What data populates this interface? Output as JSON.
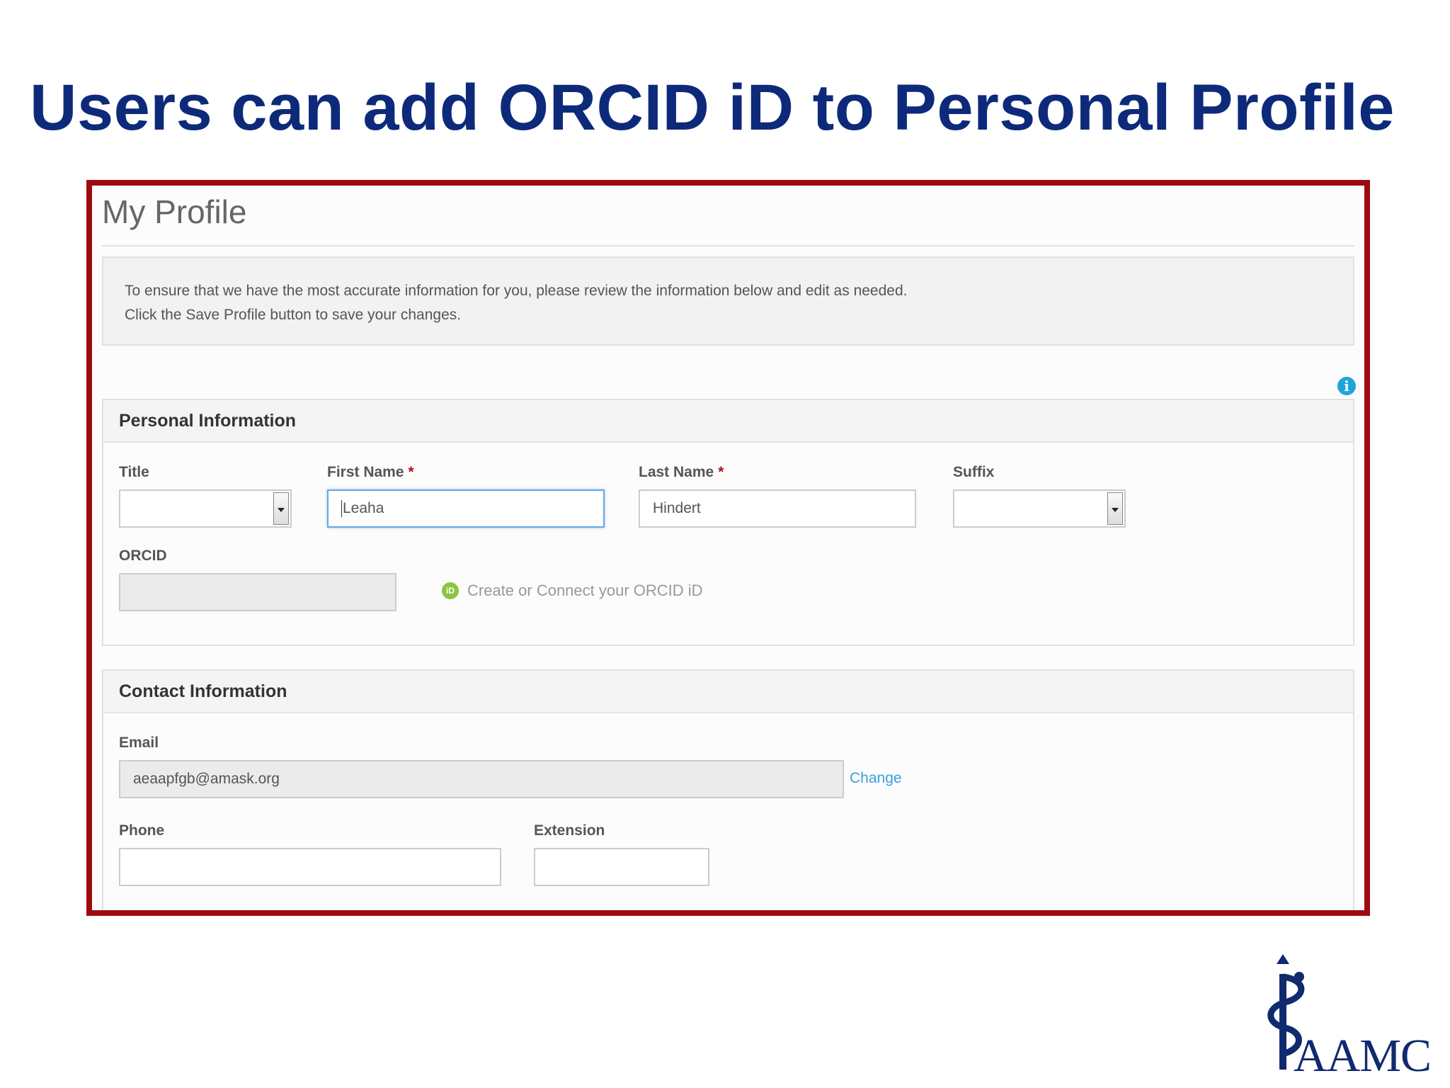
{
  "slide": {
    "title": "Users can add ORCID iD to Personal Profile"
  },
  "profile": {
    "heading": "My Profile",
    "notice_line1": "To ensure that we have the most accurate information for you, please review the information below and edit as needed.",
    "notice_line2": "Click the Save Profile button to save your changes."
  },
  "personal": {
    "header": "Personal Information",
    "title_label": "Title",
    "title_value": "",
    "first_name_label": "First Name",
    "first_name_value": "Leaha",
    "last_name_label": "Last Name",
    "last_name_value": "Hindert",
    "suffix_label": "Suffix",
    "suffix_value": "",
    "required_marker": "*",
    "orcid_label": "ORCID",
    "orcid_value": "",
    "orcid_link": "Create or Connect your ORCID iD",
    "orcid_icon_text": "iD"
  },
  "contact": {
    "header": "Contact Information",
    "email_label": "Email",
    "email_value": "aeaapfgb@amask.org",
    "change_link": "Change",
    "phone_label": "Phone",
    "phone_value": "",
    "extension_label": "Extension",
    "extension_value": ""
  },
  "logo": {
    "text": "AAMC",
    "icon": "rod-of-asclepius-icon"
  },
  "colors": {
    "title": "#0d2a7a",
    "frame_border": "#9e0b0f",
    "link": "#3aa0d8",
    "orcid_green": "#8cc540",
    "info_blue": "#1ea5d8"
  },
  "icons": {
    "info": "info-icon",
    "orcid": "orcid-icon",
    "select_arrow": "chevron-down-icon"
  }
}
